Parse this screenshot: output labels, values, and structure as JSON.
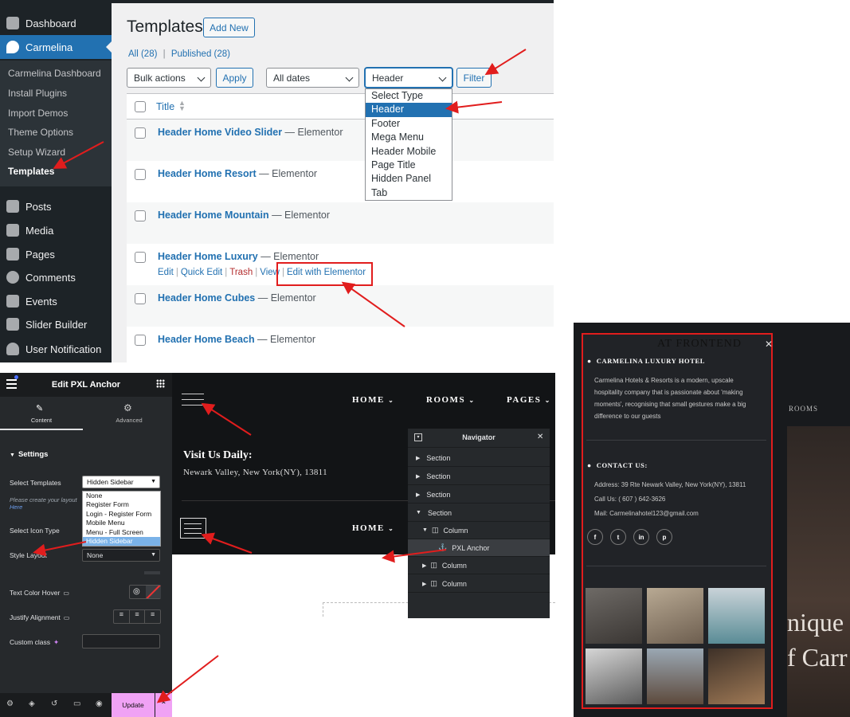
{
  "wp": {
    "menu": [
      {
        "label": "Dashboard",
        "icon": "dashboard-icon"
      },
      {
        "label": "Carmelina",
        "icon": "carmelina-icon"
      },
      {
        "label": "Posts",
        "icon": "pin-icon"
      },
      {
        "label": "Media",
        "icon": "media-icon"
      },
      {
        "label": "Pages",
        "icon": "pages-icon"
      },
      {
        "label": "Comments",
        "icon": "comment-icon"
      },
      {
        "label": "Events",
        "icon": "folder-icon"
      },
      {
        "label": "Slider Builder",
        "icon": "slider-icon"
      },
      {
        "label": "User Notification",
        "icon": "user-icon"
      }
    ],
    "submenu": [
      "Carmelina Dashboard",
      "Install Plugins",
      "Import Demos",
      "Theme Options",
      "Setup Wizard",
      "Templates"
    ],
    "title": "Templates",
    "add_new": "Add New",
    "filter_all": "All (28)",
    "filter_sep": "|",
    "filter_published": "Published (28)",
    "bulk_actions": "Bulk actions",
    "apply": "Apply",
    "all_dates": "All dates",
    "type_selected": "Header",
    "filter_btn": "Filter",
    "type_options": [
      "Select Type",
      "Header",
      "Footer",
      "Mega Menu",
      "Header Mobile",
      "Page Title",
      "Hidden Panel",
      "Tab"
    ],
    "col_title": "Title",
    "rows": [
      {
        "title": "Header Home Video Slider",
        "suffix": " — Elementor"
      },
      {
        "title": "Header Home Resort",
        "suffix": " — Elementor"
      },
      {
        "title": "Header Home Mountain",
        "suffix": " — Elementor"
      },
      {
        "title": "Header Home Luxury",
        "suffix": " — Elementor"
      },
      {
        "title": "Header Home Cubes",
        "suffix": " — Elementor"
      },
      {
        "title": "Header Home Beach",
        "suffix": " — Elementor"
      }
    ],
    "row_actions": {
      "edit": "Edit",
      "quick_edit": "Quick Edit",
      "trash": "Trash",
      "view": "View",
      "edit_elementor": "Edit with Elementor",
      "sep": "|"
    }
  },
  "elementor": {
    "panel_title": "Edit PXL Anchor",
    "tab_content": "Content",
    "tab_advanced": "Advanced",
    "section_settings": "Settings",
    "select_templates_label": "Select Templates",
    "select_templates_value": "Hidden Sidebar",
    "template_options": [
      "None",
      "Register Form",
      "Login - Register Form",
      "Mobile Menu",
      "Menu - Full Screen",
      "Hidden Sidebar"
    ],
    "hint": "Please create your layout",
    "hint_link": "Here",
    "select_icon_type": "Select Icon Type",
    "style_layout_label": "Style Layout",
    "style_layout_value": "None",
    "text_color_hover": "Text Color Hover",
    "justify_alignment": "Justify Alignment",
    "custom_class": "Custom class",
    "update": "Update",
    "preview": {
      "nav": [
        "HOME",
        "ROOMS",
        "PAGES"
      ],
      "visit_title": "Visit Us Daily:",
      "address": "Newark Valley, New York(NY), 13811",
      "nav2": "HOME"
    },
    "navigator": {
      "title": "Navigator",
      "items": [
        {
          "label": "Section",
          "level": 0,
          "type": "section"
        },
        {
          "label": "Section",
          "level": 0,
          "type": "section"
        },
        {
          "label": "Section",
          "level": 0,
          "type": "section"
        },
        {
          "label": "Section",
          "level": 0,
          "type": "section-open"
        },
        {
          "label": "Column",
          "level": 1,
          "type": "column-open"
        },
        {
          "label": "PXL Anchor",
          "level": 2,
          "type": "widget"
        },
        {
          "label": "Column",
          "level": 1,
          "type": "column"
        },
        {
          "label": "Column",
          "level": 1,
          "type": "column"
        }
      ]
    }
  },
  "frontend": {
    "caption": "AT FRONTEND",
    "hotel_title": "CARMELINA LUXURY HOTEL",
    "hotel_desc": [
      "Carmelina Hotels & Resorts is a modern, upscale",
      "hospitality company that is passionate about 'making",
      "moments', recognising that small gestures make a big",
      "difference to our guests"
    ],
    "contact_title": "CONTACT US:",
    "address": "Address: 39 Rte Newark Valley, New York(NY), 13811",
    "call": "Call Us: ( 607 ) 642-3626",
    "mail": "Mail: Carmelinahotel123@gmail.com",
    "socials": [
      "f",
      "t",
      "in",
      "p"
    ],
    "bg_text1": "nique",
    "bg_text2": "f Carr",
    "bg_nav": "ROOMS"
  }
}
